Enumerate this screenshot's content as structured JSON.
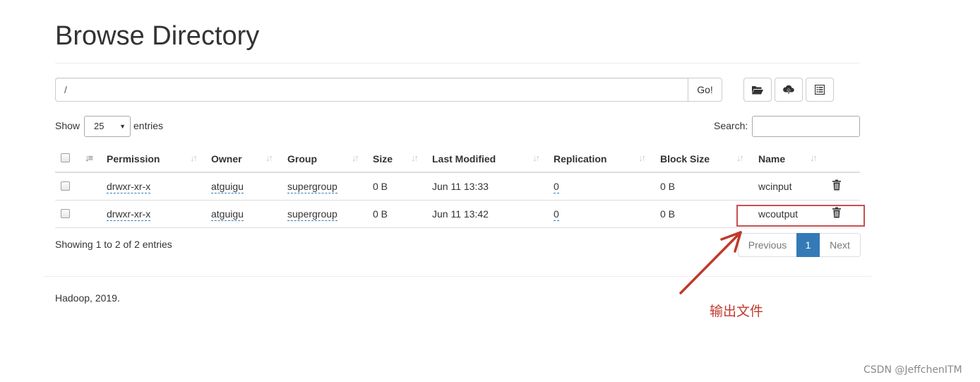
{
  "page": {
    "title": "Browse Directory"
  },
  "toolbar": {
    "path_value": "/",
    "go_label": "Go!",
    "icons": [
      "folder-open-icon",
      "cloud-upload-icon",
      "list-icon"
    ]
  },
  "table_controls": {
    "show_label": "Show",
    "page_size": "25",
    "entries_label": "entries",
    "search_label": "Search:",
    "search_value": ""
  },
  "table": {
    "columns": [
      "Permission",
      "Owner",
      "Group",
      "Size",
      "Last Modified",
      "Replication",
      "Block Size",
      "Name"
    ],
    "rows": [
      {
        "permission": "drwxr-xr-x",
        "owner": "atguigu",
        "group": "supergroup",
        "size": "0 B",
        "last_modified": "Jun 11 13:33",
        "replication": "0",
        "block_size": "0 B",
        "name": "wcinput"
      },
      {
        "permission": "drwxr-xr-x",
        "owner": "atguigu",
        "group": "supergroup",
        "size": "0 B",
        "last_modified": "Jun 11 13:42",
        "replication": "0",
        "block_size": "0 B",
        "name": "wcoutput"
      }
    ]
  },
  "pagination": {
    "info": "Showing 1 to 2 of 2 entries",
    "previous": "Previous",
    "current": "1",
    "next": "Next"
  },
  "footer": {
    "copyright": "Hadoop, 2019."
  },
  "annotation": {
    "text": "输出文件",
    "color": "#c9504f"
  },
  "watermark": "CSDN @JeffchenITM",
  "colors": {
    "link": "#337ab7",
    "active_page": "#337ab7"
  }
}
